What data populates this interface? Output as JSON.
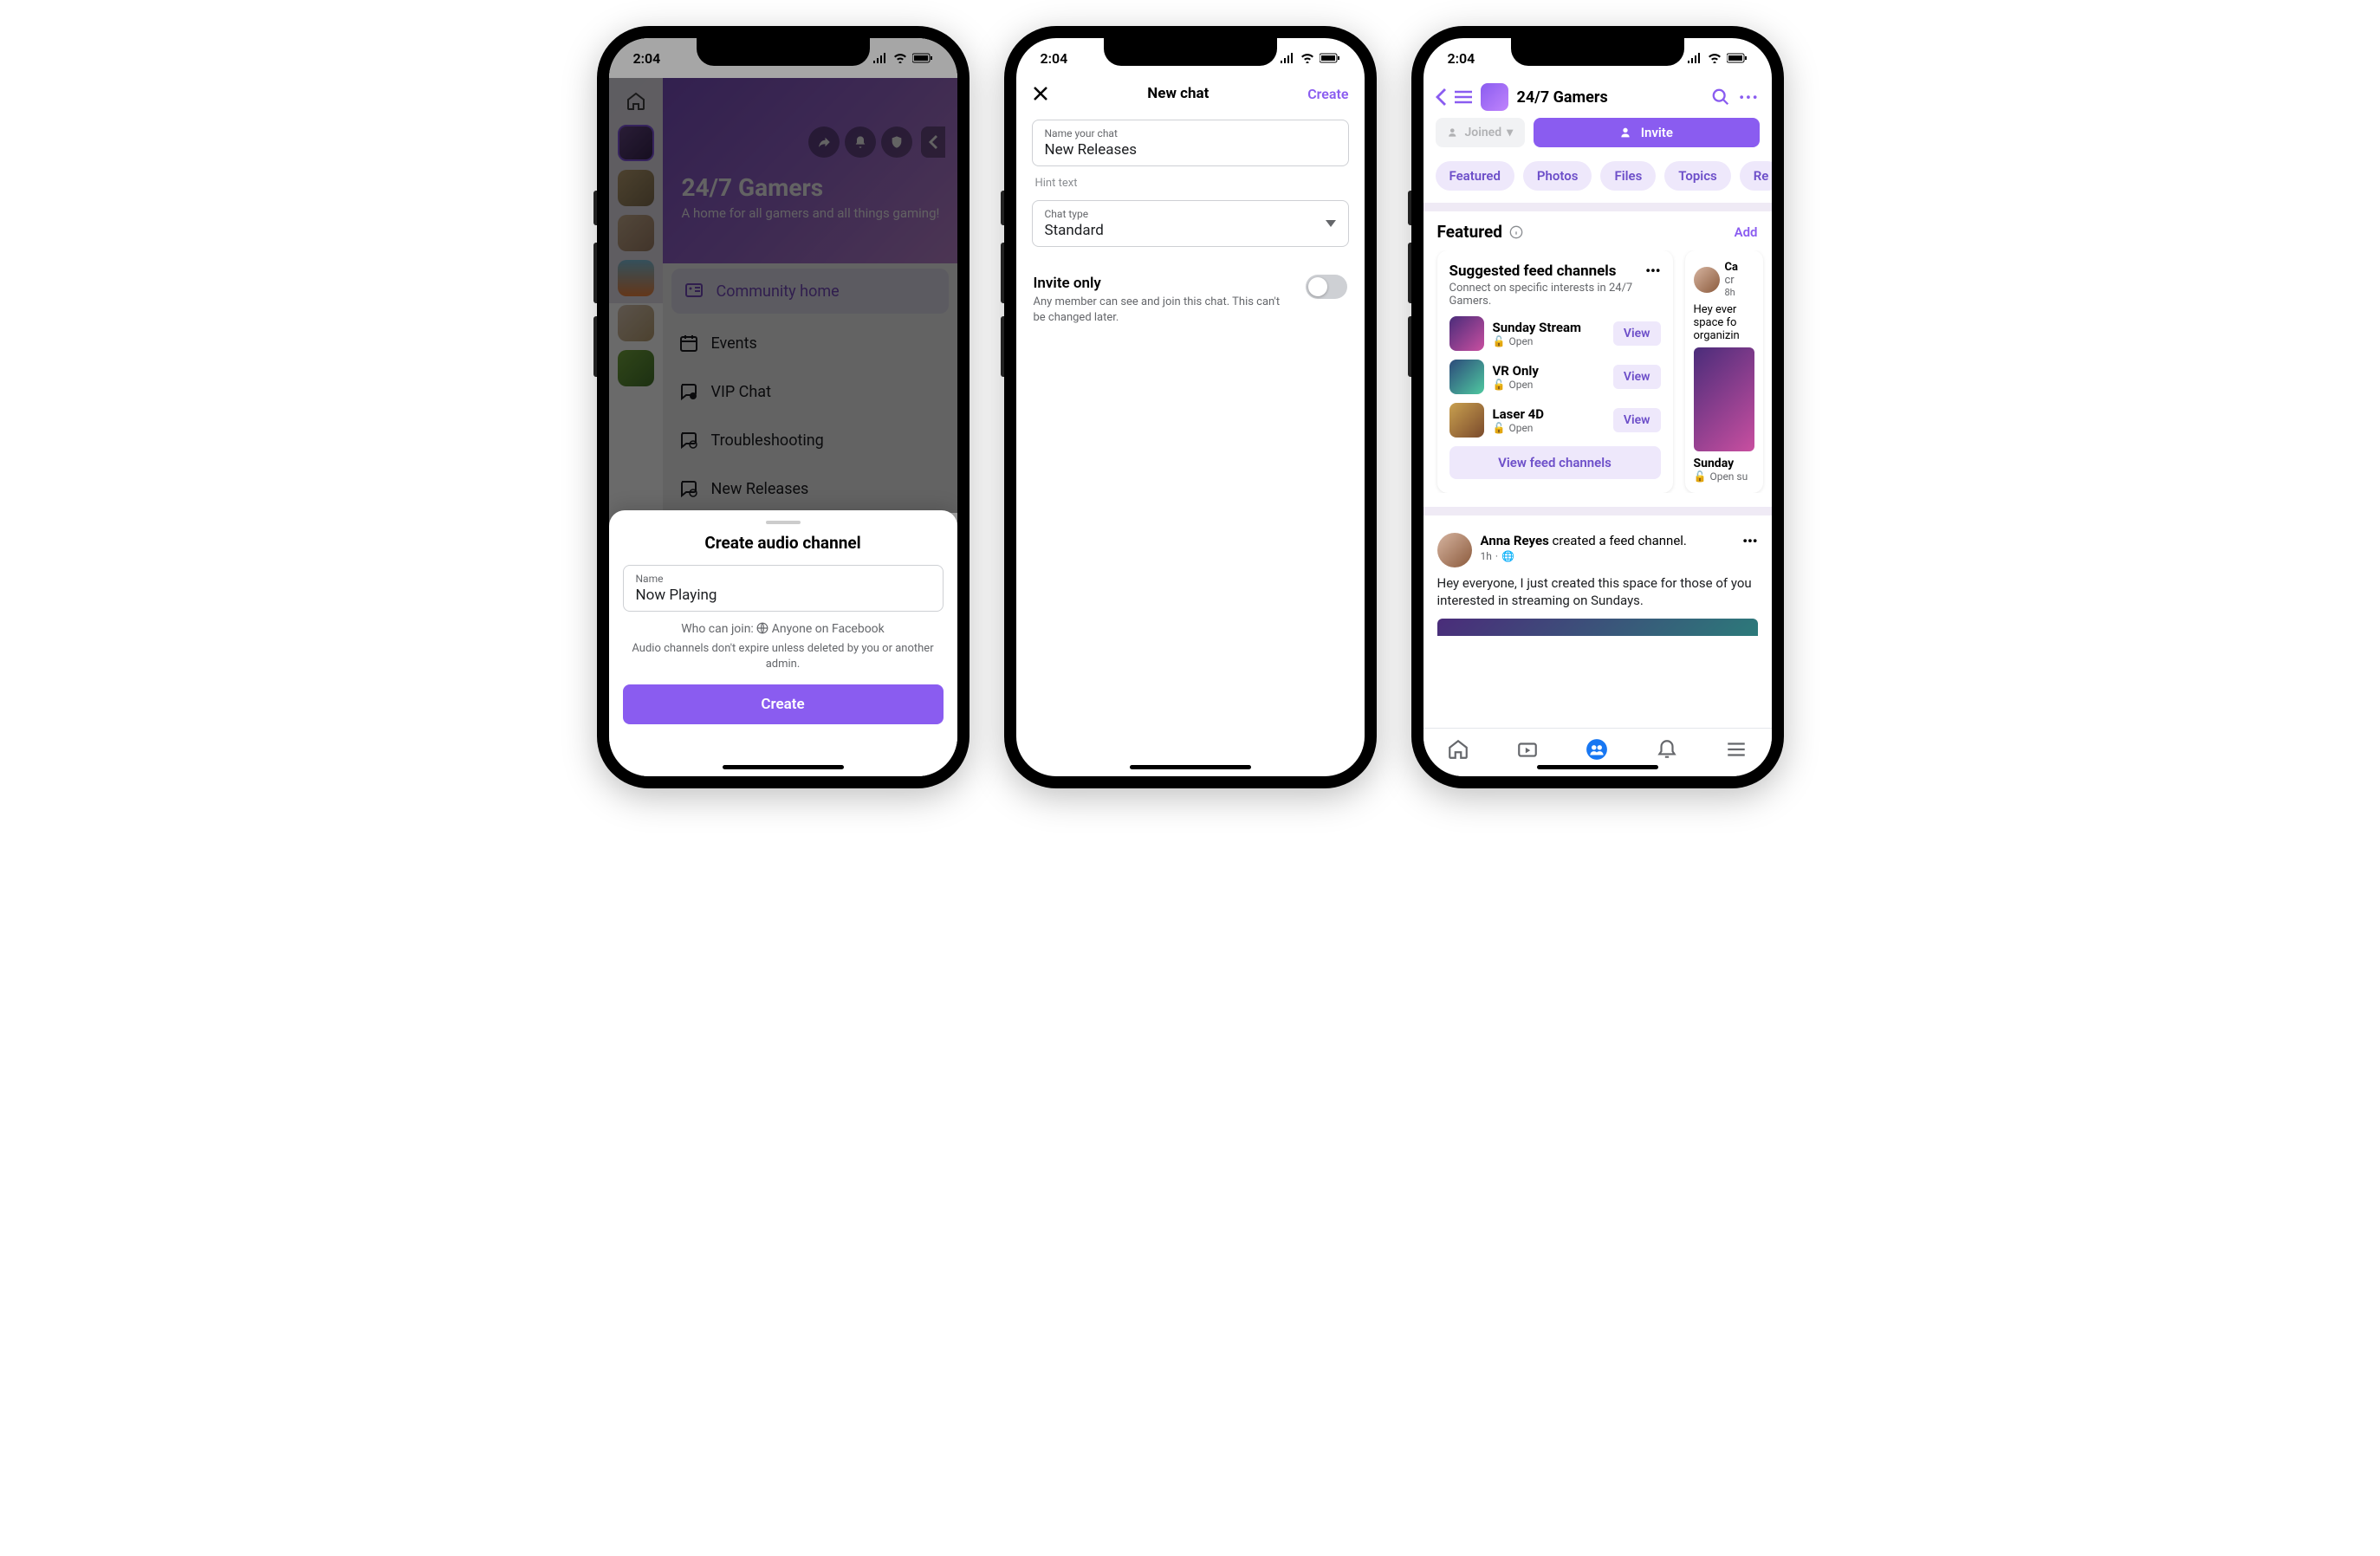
{
  "status": {
    "time": "2:04"
  },
  "phone1": {
    "group_name": "24/7 Gamers",
    "group_tagline": "A home for all gamers and all things gaming!",
    "menu": {
      "community_home": "Community home",
      "events": "Events",
      "vip_chat": "VIP Chat",
      "troubleshooting": "Troubleshooting",
      "new_releases": "New Releases"
    },
    "sheet": {
      "title": "Create audio channel",
      "name_label": "Name",
      "name_value": "Now Playing",
      "who_prefix": "Who can join: ",
      "who_value": "Anyone on Facebook",
      "desc": "Audio channels don't expire unless deleted by you or another admin.",
      "create": "Create"
    }
  },
  "phone2": {
    "title": "New chat",
    "create": "Create",
    "name_label": "Name your chat",
    "name_value": "New Releases",
    "hint": "Hint text",
    "type_label": "Chat type",
    "type_value": "Standard",
    "invite_title": "Invite only",
    "invite_sub": "Any member can see and join this chat. This can't be changed later."
  },
  "phone3": {
    "group_name": "24/7 Gamers",
    "joined": "Joined",
    "invite": "Invite",
    "chips": {
      "featured": "Featured",
      "photos": "Photos",
      "files": "Files",
      "topics": "Topics",
      "more": "Re"
    },
    "section_title": "Featured",
    "add": "Add",
    "card": {
      "title": "Suggested feed channels",
      "sub": "Connect on specific interests in 24/7 Gamers.",
      "channels": [
        {
          "name": "Sunday Stream",
          "meta": "Open"
        },
        {
          "name": "VR Only",
          "meta": "Open"
        },
        {
          "name": "Laser 4D",
          "meta": "Open"
        }
      ],
      "view": "View",
      "cta": "View feed channels"
    },
    "peek": {
      "author": "Ca",
      "action": "cr",
      "time": "8h",
      "body": "Hey ever\nspace fo\norganizin",
      "caption": "Sunday",
      "meta": "Open su"
    },
    "post": {
      "author": "Anna Reyes",
      "action": " created a feed channel.",
      "time": "1h",
      "body": "Hey everyone, I just created this space for those of you interested in streaming on Sundays."
    }
  }
}
